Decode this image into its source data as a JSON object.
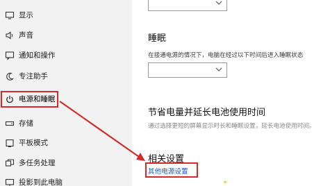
{
  "sidebar": {
    "items": [
      {
        "label": "显示",
        "icon": "display-icon"
      },
      {
        "label": "声音",
        "icon": "speaker-icon"
      },
      {
        "label": "通知和操作",
        "icon": "notification-icon"
      },
      {
        "label": "专注助手",
        "icon": "moon-icon"
      },
      {
        "label": "电源和睡眠",
        "icon": "power-icon",
        "active": true
      },
      {
        "label": "存储",
        "icon": "storage-icon"
      },
      {
        "label": "平板模式",
        "icon": "tablet-icon"
      },
      {
        "label": "多任务处理",
        "icon": "multitask-icon"
      },
      {
        "label": "投影到此电脑",
        "icon": "project-icon"
      }
    ]
  },
  "main": {
    "sleep": {
      "title": "睡眠",
      "desc": "在接通电源的情况下，电脑在经过以下时间后进入睡眠状态"
    },
    "battery": {
      "title": "节省电量并延长电池使用时间",
      "desc": "通过选择更短的屏幕显示时长和睡眠设置，延长电池使用时间。"
    },
    "related": {
      "title": "相关设置",
      "link": "其他电源设置"
    }
  },
  "colors": {
    "sidebar_bg": "#f2f2f2",
    "annotation_red": "#d42a2a",
    "link_blue": "#1a5fb4"
  }
}
